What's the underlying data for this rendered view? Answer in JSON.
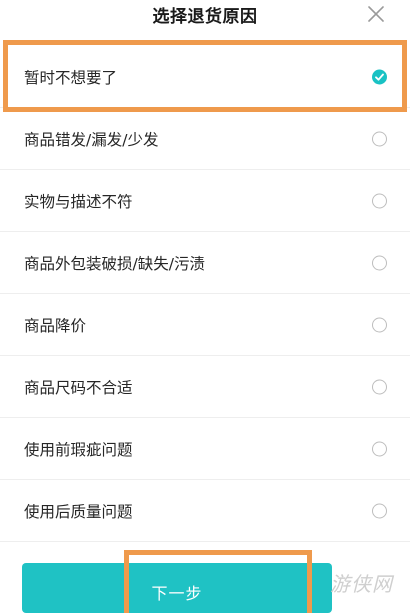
{
  "header": {
    "title": "选择退货原因",
    "close_icon": "close-icon"
  },
  "reasons": [
    {
      "label": "暂时不想要了",
      "selected": true
    },
    {
      "label": "商品错发/漏发/少发",
      "selected": false
    },
    {
      "label": "实物与描述不符",
      "selected": false
    },
    {
      "label": "商品外包装破损/缺失/污渍",
      "selected": false
    },
    {
      "label": "商品降价",
      "selected": false
    },
    {
      "label": "商品尺码不合适",
      "selected": false
    },
    {
      "label": "使用前瑕疵问题",
      "selected": false
    },
    {
      "label": "使用后质量问题",
      "selected": false
    }
  ],
  "footer": {
    "next_label": "下一步"
  },
  "watermark": {
    "text": "游侠网"
  },
  "colors": {
    "accent": "#1fc2c4",
    "annotation": "#ef9a4c",
    "radio_border": "#bdbdbd"
  }
}
